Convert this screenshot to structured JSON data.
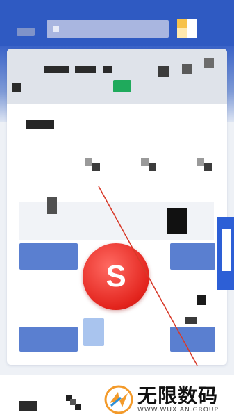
{
  "header": {
    "search_placeholder": "",
    "back_icon": "back-icon",
    "scan_icon": "scan-icon"
  },
  "info_card": {
    "status_icon": "status-green-icon"
  },
  "section": {
    "title": ""
  },
  "action": {
    "main_button_glyph": "S",
    "accent_color": "#e3241d"
  },
  "watermark": {
    "title": "无限数码",
    "subtitle": "WWW.WUXIAN.GROUP"
  },
  "colors": {
    "brand_blue": "#2f5ac2",
    "tile_blue": "#5a7fd0",
    "status_green": "#1faa5c",
    "annotation_red": "#d83a2a"
  }
}
